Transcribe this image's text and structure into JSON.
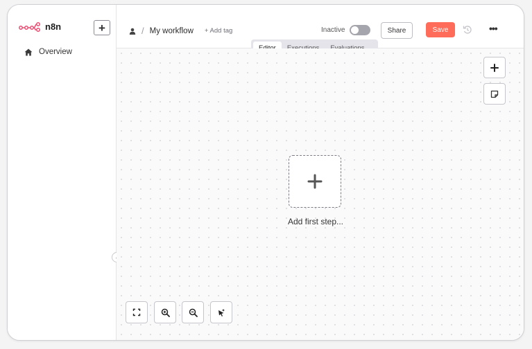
{
  "app": {
    "brand": "n8n",
    "brand_color": "#ff6d5a",
    "new_button_label": "+"
  },
  "sidebar": {
    "items": [
      {
        "label": "Overview",
        "icon": "home-icon"
      }
    ],
    "collapse_icon": "chevron-left-icon"
  },
  "header": {
    "workflow_title": "My workflow",
    "breadcrumb_separator": "/",
    "add_tag_label": "+ Add tag",
    "status_label": "Inactive",
    "active": false,
    "share_label": "Share",
    "save_label": "Save",
    "more_label": "•••"
  },
  "tabs": [
    {
      "label": "Editor",
      "active": true
    },
    {
      "label": "Executions",
      "active": false
    },
    {
      "label": "Evaluations",
      "active": false
    }
  ],
  "canvas": {
    "add_first_step_label": "Add first step...",
    "add_node_icon": "plus-icon",
    "sticky_note_icon": "sticky-note-icon",
    "zoom_controls": [
      "fit-view-icon",
      "zoom-in-icon",
      "zoom-out-icon",
      "tidy-up-icon"
    ]
  }
}
